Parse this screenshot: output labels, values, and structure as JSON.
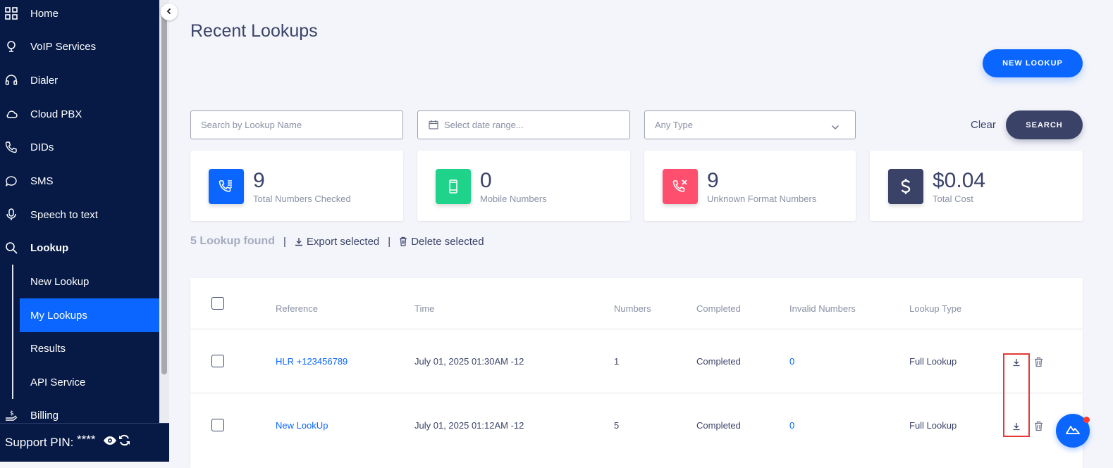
{
  "sidebar": {
    "items": [
      {
        "label": "Home",
        "icon": "grid-icon"
      },
      {
        "label": "VoIP Services",
        "icon": "voip-icon"
      },
      {
        "label": "Dialer",
        "icon": "headset-icon"
      },
      {
        "label": "Cloud PBX",
        "icon": "cloud-icon"
      },
      {
        "label": "DIDs",
        "icon": "phone-icon"
      },
      {
        "label": "SMS",
        "icon": "chat-icon"
      },
      {
        "label": "Speech to text",
        "icon": "microphone-icon"
      },
      {
        "label": "Lookup",
        "icon": "search-icon"
      }
    ],
    "sub_items": [
      {
        "label": "New Lookup"
      },
      {
        "label": "My Lookups",
        "active": true
      },
      {
        "label": "Results"
      },
      {
        "label": "API Service"
      }
    ],
    "billing": {
      "label": "Billing",
      "icon": "billing-icon"
    },
    "support": {
      "label": "Support PIN:",
      "value": "****"
    }
  },
  "page": {
    "title": "Recent Lookups",
    "new_lookup_label": "NEW LOOKUP"
  },
  "filters": {
    "search_placeholder": "Search by Lookup Name",
    "date_placeholder": "Select date range...",
    "type_value": "Any Type",
    "clear_label": "Clear",
    "search_label": "SEARCH"
  },
  "stats": [
    {
      "value": "9",
      "label": "Total Numbers Checked",
      "icon": "phone-list-icon",
      "color": "#0a66ff"
    },
    {
      "value": "0",
      "label": "Mobile Numbers",
      "icon": "mobile-icon",
      "color": "#1fd48a"
    },
    {
      "value": "9",
      "label": "Unknown Format Numbers",
      "icon": "phone-x-icon",
      "color": "#ff4f6e"
    },
    {
      "value": "$0.04",
      "label": "Total Cost",
      "icon": "dollar-icon",
      "color": "#3a4268"
    }
  ],
  "toolbar": {
    "found_label": "5 Lookup found",
    "export_label": "Export selected",
    "delete_label": "Delete selected"
  },
  "table": {
    "headers": [
      "Reference",
      "Time",
      "Numbers",
      "Completed",
      "Invalid Numbers",
      "Lookup Type"
    ],
    "rows": [
      {
        "reference": "HLR +123456789",
        "time": "July 01, 2025 01:30AM -12",
        "numbers": "1",
        "completed": "Completed",
        "invalid": "0",
        "type": "Full Lookup"
      },
      {
        "reference": "New LookUp",
        "time": "July 01, 2025 01:12AM -12",
        "numbers": "5",
        "completed": "Completed",
        "invalid": "0",
        "type": "Full Lookup"
      }
    ]
  },
  "colors": {
    "sidebar_bg": "#061a45",
    "accent": "#0a66ff",
    "dark_button": "#3a4268",
    "highlight": "#e53935"
  }
}
